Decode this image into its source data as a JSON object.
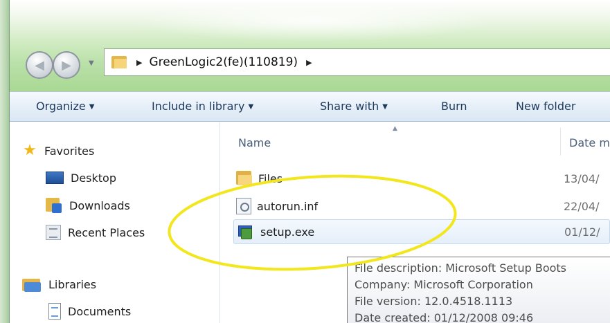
{
  "address_bar": {
    "crumbs": [
      "GreenLogic2(fe)(110819)"
    ]
  },
  "toolbar": {
    "organize": "Organize",
    "include_in_library": "Include in library",
    "share_with": "Share with",
    "burn": "Burn",
    "new_folder": "New folder"
  },
  "sidebar": {
    "favorites": {
      "label": "Favorites",
      "icon": "star-icon",
      "items": [
        {
          "label": "Desktop",
          "icon": "desktop-icon"
        },
        {
          "label": "Downloads",
          "icon": "downloads-folder-icon"
        },
        {
          "label": "Recent Places",
          "icon": "recent-places-icon"
        }
      ]
    },
    "libraries": {
      "label": "Libraries",
      "icon": "libraries-icon",
      "items": [
        {
          "label": "Documents",
          "icon": "documents-icon"
        }
      ]
    }
  },
  "columns": {
    "name": "Name",
    "date": "Date m"
  },
  "files": [
    {
      "name": "Files",
      "date": "13/04/",
      "icon": "folder-icon"
    },
    {
      "name": "autorun.inf",
      "date": "22/04/",
      "icon": "setup-info-file-icon"
    },
    {
      "name": "setup.exe",
      "date": "01/12/",
      "icon": "installer-exe-icon"
    }
  ],
  "tooltip": {
    "lines": [
      "File description: Microsoft Setup Boots",
      "Company: Microsoft Corporation",
      "File version: 12.0.4518.1113",
      "Date created: 01/12/2008 09:46"
    ]
  },
  "colors": {
    "annotation_circle": "#f2e61c",
    "titlebar_green": "#b9e0a8",
    "toolbar_text": "#1e395b"
  }
}
